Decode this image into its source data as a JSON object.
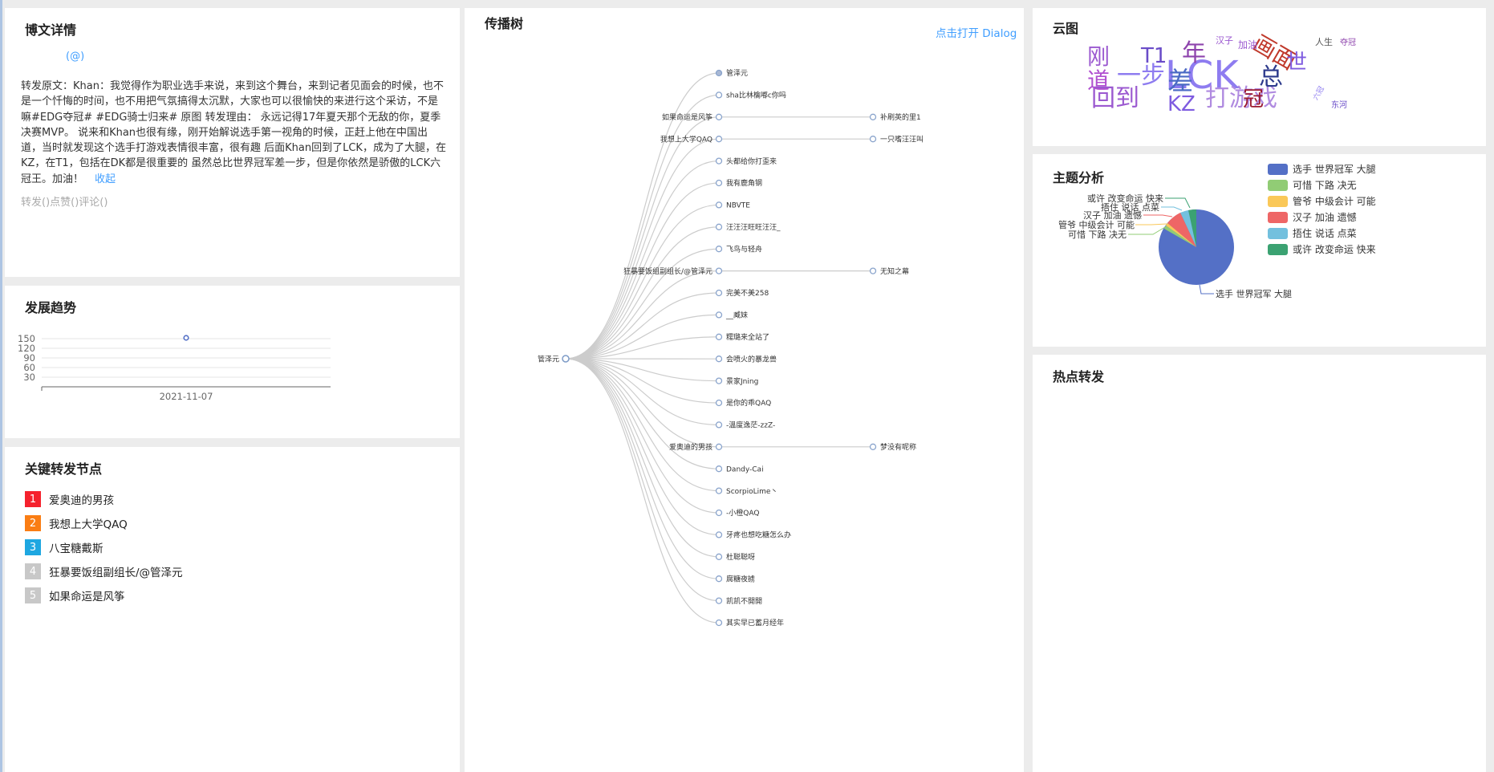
{
  "blog": {
    "title": "博文详情",
    "mention": "(@)",
    "text": "转发原文：Khan：我觉得作为职业选手来说，来到这个舞台，来到记者见面会的时候，也不是一个忏悔的时间，也不用把气氛搞得太沉默，大家也可以很愉快的来进行这个采访，不是嘛#EDG夺冠# #EDG骑士归来#   原图   转发理由：  永远记得17年夏天那个无敌的你，夏季决赛MVP。 说来和Khan也很有缘，刚开始解说选手第一视角的时候，正赶上他在中国出道，当时就发现这个选手打游戏表情很丰富，很有趣 后面Khan回到了LCK，成为了大腿，在KZ，在T1，包括在DK都是很重要的 虽然总比世界冠军差一步，但是你依然是骄傲的LCK六冠王。加油！",
    "collapse": "收起",
    "meta": "转发()点赞()评论()"
  },
  "trend": {
    "title": "发展趋势",
    "y_ticks": [
      "150",
      "120",
      "90",
      "60",
      "30"
    ],
    "x_label": "2021-11-07"
  },
  "key_nodes": {
    "title": "关键转发节点",
    "items": [
      {
        "rank": "1",
        "name": "爱奥迪的男孩",
        "color": "#f5222d"
      },
      {
        "rank": "2",
        "name": "我想上大学QAQ",
        "color": "#fa7d14"
      },
      {
        "rank": "3",
        "name": "八宝糖戴斯",
        "color": "#1ea7e1"
      },
      {
        "rank": "4",
        "name": "狂暴要饭组副组长/@管泽元",
        "color": "#c8c8c8"
      },
      {
        "rank": "5",
        "name": "如果命运是风筝",
        "color": "#c8c8c8"
      }
    ]
  },
  "tree": {
    "title": "传播树",
    "dialog_link": "点击打开 Dialog",
    "root": "管泽元",
    "children": [
      {
        "name": "管泽元"
      },
      {
        "name": "sha比林檎嘟c你吗"
      },
      {
        "name": "如果命运是风筝",
        "child": "补刷英的里1"
      },
      {
        "name": "我想上大学QAQ",
        "child": "一只嗜汪汪叫"
      },
      {
        "name": "头都给你打歪来"
      },
      {
        "name": "我有鹿角钢"
      },
      {
        "name": "NBVTE"
      },
      {
        "name": "汪汪汪旺旺汪汪_"
      },
      {
        "name": "飞鸟与轻舟"
      },
      {
        "name": "狂暴要饭组副组长/@管泽元",
        "child": "无知之幕"
      },
      {
        "name": "完美不美258"
      },
      {
        "name": "__臧妹"
      },
      {
        "name": "糯璐来全站了"
      },
      {
        "name": "会喷火的暴龙兽"
      },
      {
        "name": "景家Jning"
      },
      {
        "name": "是你的乖QAQ"
      },
      {
        "name": "-溫度逸茫-zzZ-"
      },
      {
        "name": "爱奥迪的男孩",
        "child": "梦没有呢称"
      },
      {
        "name": "Dandy-Cai"
      },
      {
        "name": "ScorpioLime丶"
      },
      {
        "name": "-小橙QAQ"
      },
      {
        "name": "牙疼也想吃糖怎么办"
      },
      {
        "name": "杜聪聪呀"
      },
      {
        "name": "腐糖夜掳"
      },
      {
        "name": "凯凯不開開"
      },
      {
        "name": "其实早已蓄月经年"
      }
    ]
  },
  "cloud": {
    "title": "云图",
    "words": [
      {
        "text": "LCK",
        "color": "#8e7cf0"
      },
      {
        "text": "打游戏",
        "color": "#b08be0"
      },
      {
        "text": "回到",
        "color": "#9b59d0"
      },
      {
        "text": "一步",
        "color": "#8e7cf0"
      },
      {
        "text": "差",
        "color": "#4b6bc4"
      },
      {
        "text": "KZ",
        "color": "#7f5ce0"
      },
      {
        "text": "刚",
        "color": "#9b59d0"
      },
      {
        "text": "道",
        "color": "#b04fd0"
      },
      {
        "text": "T1",
        "color": "#6a4cc8"
      },
      {
        "text": "年",
        "color": "#8e44ad"
      },
      {
        "text": "总",
        "color": "#2d3a8c"
      },
      {
        "text": "画面",
        "color": "#c0392b"
      },
      {
        "text": "冠",
        "color": "#9b1b30"
      },
      {
        "text": "世",
        "color": "#7f5ce0"
      },
      {
        "text": "汉子",
        "color": "#9b59d0"
      },
      {
        "text": "加油",
        "color": "#9b59d0"
      },
      {
        "text": "人生",
        "color": "#555"
      },
      {
        "text": "夺冠",
        "color": "#8e44ad"
      },
      {
        "text": "六冠",
        "color": "#8e7cf0"
      },
      {
        "text": "东河",
        "color": "#6a4cc8"
      }
    ]
  },
  "topic": {
    "title": "主题分析",
    "legend": [
      {
        "label": "选手 世界冠军 大腿",
        "color": "#5470c6"
      },
      {
        "label": "可惜 下路 决无",
        "color": "#91cc75"
      },
      {
        "label": "管爷 中级会计 可能",
        "color": "#fac858"
      },
      {
        "label": "汉子 加油 遗憾",
        "color": "#ee6666"
      },
      {
        "label": "捂住 说话 点菜",
        "color": "#73c0de"
      },
      {
        "label": "或许 改变命运 快来",
        "color": "#3ba272"
      }
    ],
    "pie_labels": {
      "a": "或许 改变命运 快来",
      "b": "捂住 说话 点菜",
      "c": "汉子 加油 遗憾",
      "d": "管爷 中级会计 可能",
      "e": "可惜 下路 决无",
      "f": "选手 世界冠军 大腿"
    }
  },
  "hot": {
    "title": "热点转发"
  },
  "chart_data": {
    "type": "pie",
    "categories": [
      "选手 世界冠军 大腿",
      "可惜 下路 决无",
      "管爷 中级会计 可能",
      "汉子 加油 遗憾",
      "捂住 说话 点菜",
      "或许 改变命运 快来"
    ],
    "values": [
      91,
      1,
      1,
      5,
      1,
      1
    ],
    "title": "主题分析"
  }
}
